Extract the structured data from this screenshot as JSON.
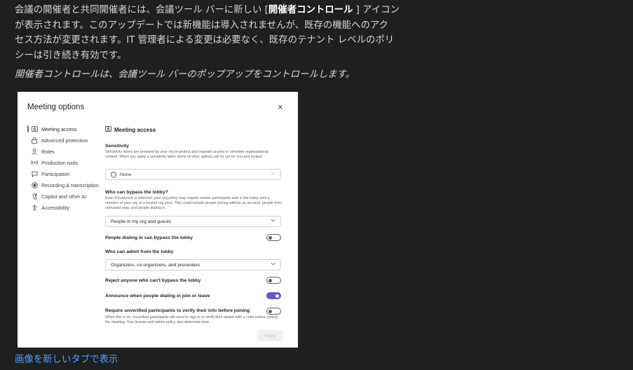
{
  "article": {
    "para_line1_before": "会議の開催者と共同開催者には、会議ツール バーに新しい [",
    "para_bold": "開催者コントロール",
    "para_line1_after": " ] アイコン",
    "para_line2": "が表示されます。このアップデートでは新機能は導入されませんが、既存の機能へのアク",
    "para_line3": "セス方法が変更されます。IT 管理者による変更は必要なく、既存のテナント レベルのポリ",
    "para_line4": "シーは引き続き有効です。",
    "caption": "開催者コントロールは、会議ツール バーのポップアップをコントロールします。",
    "link": "画像を新しいタブで表示"
  },
  "dialog": {
    "title": "Meeting options",
    "close_glyph": "×",
    "nav": [
      {
        "label": "Meeting access",
        "icon": "meeting-access-icon",
        "active": true
      },
      {
        "label": "Advanced protection",
        "icon": "lock-icon",
        "active": false
      },
      {
        "label": "Roles",
        "icon": "person-icon",
        "active": false
      },
      {
        "label": "Production tools",
        "icon": "broadcast-icon",
        "active": false
      },
      {
        "label": "Participation",
        "icon": "chat-icon",
        "active": false
      },
      {
        "label": "Recording & transcription",
        "icon": "record-icon",
        "active": false
      },
      {
        "label": "Copilot and other AI",
        "icon": "copilot-icon",
        "active": false
      },
      {
        "label": "Accessibility",
        "icon": "accessibility-icon",
        "active": false
      }
    ],
    "section_title": "Meeting access",
    "sensitivity": {
      "label": "Sensitivity",
      "desc": "Sensitivity labels are provided by your org to protect and regulate access to sensitive organizational content. When you apply a sensitivity label, some of other options will be set for you and locked.",
      "value": "None"
    },
    "bypass": {
      "label": "Who can bypass the lobby?",
      "desc": "Even if Everyone is selected, your org policy may require certain participants wait in the lobby until a member of your org or a trusted org joins. This could include people joining without an account, people from untrusted orgs, and people dialing in.",
      "value": "People in my org and guests"
    },
    "dialing_bypass": {
      "label": "People dialing in can bypass the lobby",
      "on": false
    },
    "admit": {
      "label": "Who can admit from the lobby",
      "value": "Organizers, co-organizers, and presenters"
    },
    "reject": {
      "label": "Reject anyone who can't bypass the lobby",
      "on": false
    },
    "announce": {
      "label": "Announce when people dialing in join or leave",
      "on": true
    },
    "verify": {
      "label": "Require unverified participants to verify their info before joining",
      "desc": "When this is on, unverified participants will need to sign in or verify their details with a code before joining the meeting. Your license and admin policy also determine how",
      "on": false
    },
    "apply_label": "Apply",
    "accent": "#5b5fc7"
  }
}
